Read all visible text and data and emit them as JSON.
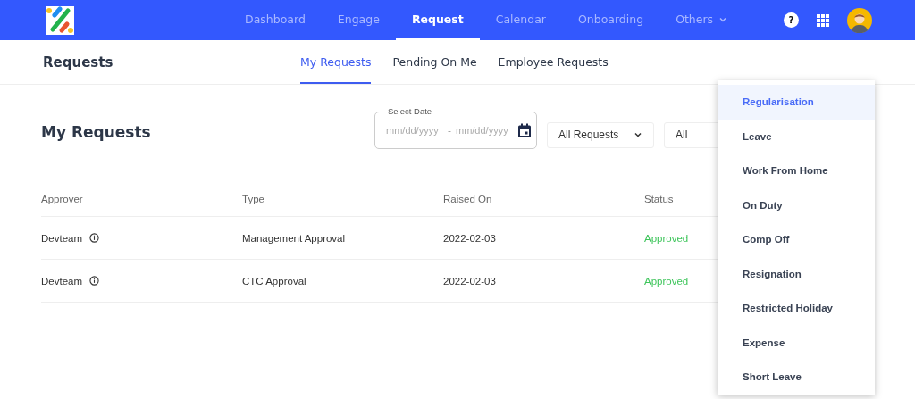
{
  "top_nav": [
    {
      "label": "Dashboard",
      "selected": false
    },
    {
      "label": "Engage",
      "selected": false
    },
    {
      "label": "Request",
      "selected": true
    },
    {
      "label": "Calendar",
      "selected": false
    },
    {
      "label": "Onboarding",
      "selected": false
    },
    {
      "label": "Others",
      "selected": false,
      "has_caret": true
    }
  ],
  "help_label": "?",
  "page_title": "Requests",
  "tabs": [
    {
      "label": "My Requests",
      "selected": true
    },
    {
      "label": "Pending On Me",
      "selected": false
    },
    {
      "label": "Employee Requests",
      "selected": false
    }
  ],
  "section_title": "My Requests",
  "date_field": {
    "label": "Select Date",
    "start_placeholder": "mm/dd/yyyy",
    "separator": "-",
    "end_placeholder": "mm/dd/yyyy"
  },
  "request_filter": {
    "value": "All Requests"
  },
  "status_filter": {
    "value": "All"
  },
  "table": {
    "columns": [
      "Approver",
      "Type",
      "Raised On",
      "Status"
    ],
    "rows": [
      {
        "approver": "Devteam",
        "type": "Management Approval",
        "raised_on": "2022-02-03",
        "status": "Approved"
      },
      {
        "approver": "Devteam",
        "type": "CTC Approval",
        "raised_on": "2022-02-03",
        "status": "Approved"
      }
    ]
  },
  "dropdown_menu": [
    {
      "label": "Regularisation",
      "selected": true
    },
    {
      "label": "Leave",
      "selected": false
    },
    {
      "label": "Work From Home",
      "selected": false
    },
    {
      "label": "On Duty",
      "selected": false
    },
    {
      "label": "Comp Off",
      "selected": false
    },
    {
      "label": "Resignation",
      "selected": false
    },
    {
      "label": "Restricted Holiday",
      "selected": false
    },
    {
      "label": "Expense",
      "selected": false
    },
    {
      "label": "Short Leave",
      "selected": false
    }
  ]
}
